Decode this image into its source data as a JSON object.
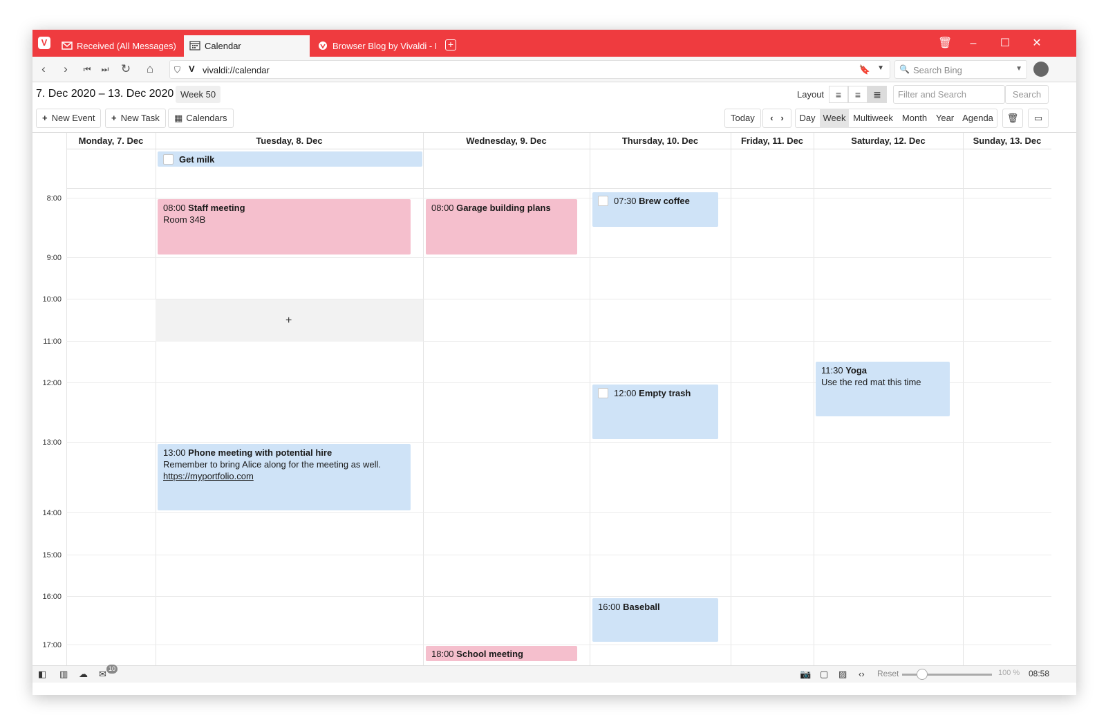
{
  "tabs": [
    {
      "label": "Received (All Messages)",
      "icon": "mail-icon"
    },
    {
      "label": "Calendar",
      "icon": "calendar-icon"
    },
    {
      "label": "Browser Blog by Vivaldi - N",
      "icon": "vivaldi-icon"
    }
  ],
  "address": {
    "url": "vivaldi://calendar",
    "search_placeholder": "Search Bing"
  },
  "calendar": {
    "date_range": "7. Dec 2020 – 13. Dec 2020",
    "week": "Week 50",
    "layout_label": "Layout",
    "filter_placeholder": "Filter and Search",
    "search_label": "Search",
    "new_event": "New Event",
    "new_task": "New Task",
    "calendars": "Calendars",
    "today": "Today",
    "views": [
      "Day",
      "Week",
      "Multiweek",
      "Month",
      "Year",
      "Agenda"
    ],
    "selected_view": "Week",
    "days": [
      "Monday, 7. Dec",
      "Tuesday, 8. Dec",
      "Wednesday, 9. Dec",
      "Thursday, 10. Dec",
      "Friday, 11. Dec",
      "Saturday, 12. Dec",
      "Sunday, 13. Dec"
    ],
    "hours": [
      "8:00",
      "9:00",
      "10:00",
      "11:00",
      "12:00",
      "13:00",
      "14:00",
      "15:00",
      "16:00",
      "17:00"
    ],
    "add_symbol": "+",
    "events": {
      "get_milk": {
        "title": "Get milk"
      },
      "staff": {
        "time": "08:00",
        "title": "Staff meeting",
        "location": "Room 34B"
      },
      "garage": {
        "time": "08:00",
        "title": "Garage building plans"
      },
      "coffee": {
        "time": "07:30",
        "title": "Brew coffee"
      },
      "yoga": {
        "time": "11:30",
        "title": "Yoga",
        "note": "Use the red mat this time"
      },
      "trash": {
        "time": "12:00",
        "title": "Empty trash"
      },
      "phone": {
        "time": "13:00",
        "title": "Phone meeting with potential hire",
        "note": "Remember to bring Alice along for the meeting as well.",
        "link": "https://myportfolio.com"
      },
      "baseball": {
        "time": "16:00",
        "title": "Baseball"
      },
      "school": {
        "time": "18:00",
        "title": "School meeting"
      }
    }
  },
  "status": {
    "mail_count": "10",
    "reset": "Reset",
    "zoom": "100 %",
    "clock": "08:58"
  },
  "colors": {
    "brand": "#ef3b3f",
    "event_pink": "#f5bfcd",
    "event_blue": "#cfe3f7"
  }
}
